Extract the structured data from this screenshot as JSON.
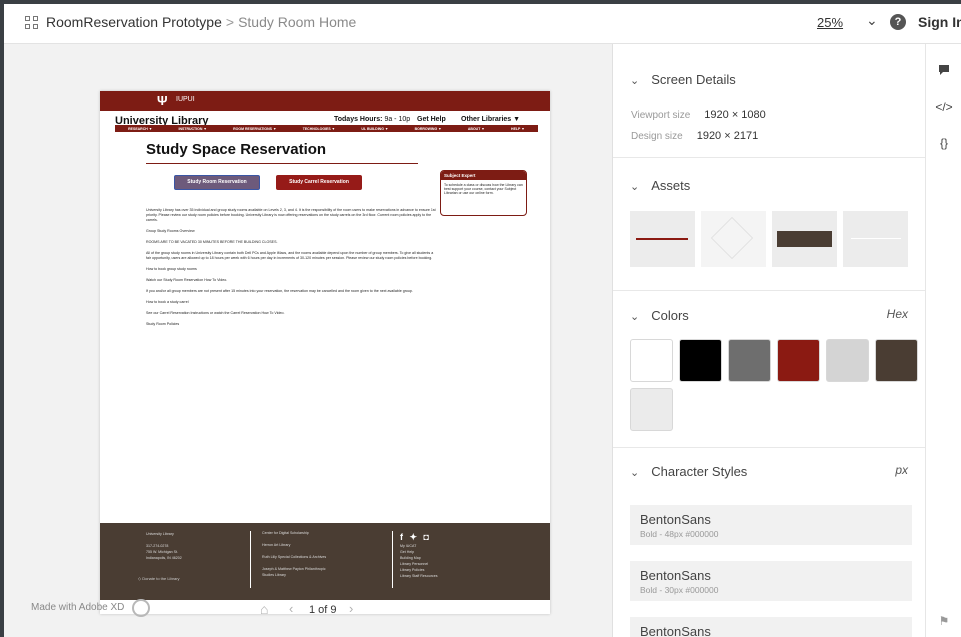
{
  "header": {
    "project": "RoomReservation Prototype",
    "separator": ">",
    "screen": "Study Room Home",
    "zoom": "25%",
    "help": "?",
    "sign_in": "Sign In"
  },
  "artboard": {
    "campus": "IUPUI",
    "site": "University Library",
    "hours_label": "Todays Hours:",
    "hours_value": "9a - 10p",
    "get_help": "Get Help",
    "other_libraries": "Other Libraries ▼",
    "nav": [
      "RESEARCH ▼",
      "INSTRUCTION ▼",
      "ROOM RESERVATIONS ▼",
      "TECHNOLOGIES ▼",
      "UL BUILDING ▼",
      "BORROWING ▼",
      "ABOUT ▼",
      "HELP ▼"
    ],
    "title": "Study Space Reservation",
    "btn_study": "Study Room Reservation",
    "btn_carrel": "Study Carrel Reservation",
    "expert_title": "Subject Expert",
    "expert_text": "To schedule a class or discuss how the Library can best support your course, contact your Subject Librarian or use our online form.",
    "paragraphs": [
      "University Library has over 35 individual and group study rooms available on Levels 2, 3, and 4. It is the responsibility of the room users to make reservations in advance to ensure 1st priority. Please review our study room policies before booking. University Library is now offering reservations on the study carrels on the 3rd floor. Current room policies apply to the carrels.",
      "Group Study Rooms Overview",
      "ROOMS ARE TO BE VACATED 30 MINUTES BEFORE THE BUILDING CLOSES.",
      "All of the group study rooms in University Library contain both Dell PCs and Apple iMacs, and the rooms available depend upon the number of group members. To give all students a fair opportunity, users are allowed up to 18 hours per week with 6 hours per day in increments of 30-120 minutes per session. Please review our study room policies before booking.",
      "How to book group study rooms",
      "Watch our Study Room Reservation How To Video.",
      "If you and/or all group members are not present after 15 minutes into your reservation, the reservation may be cancelled and the room given to the next available group.",
      "How to book a study carrel",
      "See our Carrel Reservation Instructions or watch the Carrel Reservation How To Video.",
      "Study Room Policies"
    ],
    "footer_col1": [
      "University Library",
      "",
      "317-274-0278",
      "755 W. Michigan St.",
      "Indianapolis, IN 46202"
    ],
    "footer_donate": "Donate to the Library",
    "footer_col2": [
      "Center for Digital Scholarship",
      "",
      "Herron Art Library",
      "",
      "Ruth Lilly Special Collections & Archives",
      "",
      "Joseph & Matthew Payton Philanthropic",
      "Studies Library"
    ],
    "footer_social": "f ✦ ◘",
    "footer_col3": [
      "My IUCAT",
      "Get Help",
      "Building Map",
      "Library Personnel",
      "Library Policies",
      "Library Staff Resources"
    ]
  },
  "bottom": {
    "made_with": "Made with Adobe XD",
    "page": "1 of 9"
  },
  "panel": {
    "screen_details": {
      "title": "Screen Details",
      "viewport_label": "Viewport size",
      "viewport_value": "1920 × 1080",
      "design_label": "Design size",
      "design_value": "1920 × 2171"
    },
    "assets_title": "Assets",
    "colors": {
      "title": "Colors",
      "format": "Hex",
      "swatches": [
        "#ffffff",
        "#000000",
        "#6e6e6e",
        "#8b1a12",
        "#d4d4d4",
        "#4a3d33",
        "#ebebeb"
      ]
    },
    "char_styles": {
      "title": "Character Styles",
      "unit": "px",
      "items": [
        {
          "name": "BentonSans",
          "desc": "Bold - 48px #000000"
        },
        {
          "name": "BentonSans",
          "desc": "Bold - 30px #000000"
        },
        {
          "name": "BentonSans",
          "desc": ""
        }
      ]
    }
  },
  "rail": {
    "icons": [
      "comment-icon",
      "code-icon",
      "braces-icon",
      "flag-icon"
    ],
    "code": "</>",
    "braces": "{}"
  }
}
